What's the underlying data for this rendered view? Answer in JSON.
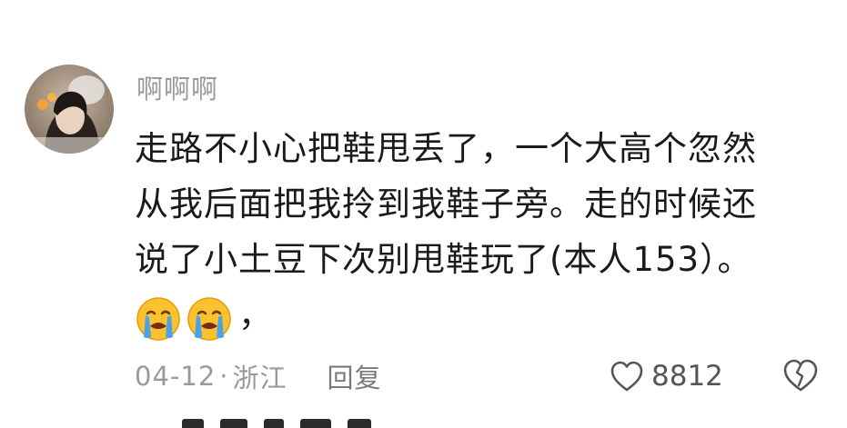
{
  "comment": {
    "username": "啊啊啊",
    "lines": [
      "走路不小心把鞋甩丢了，一个大高个忽然",
      "从我后面把我拎到我鞋子旁。走的时候还",
      "说了小土豆下次别甩鞋玩了(本人153）。"
    ],
    "emoji_icons": [
      "crying-face-emoji",
      "crying-face-emoji"
    ],
    "emoji_tail": "，",
    "date": "04-12",
    "separator": "·",
    "location": "浙江",
    "reply_label": "回复",
    "like_count": "8812"
  },
  "icons": {
    "like": "heart-outline-icon",
    "dislike": "broken-heart-icon"
  },
  "colors": {
    "text": "#1a1a1a",
    "muted": "#9a9a9a",
    "emoji_face": "#f9c22e",
    "emoji_tears": "#4aa3e8"
  }
}
